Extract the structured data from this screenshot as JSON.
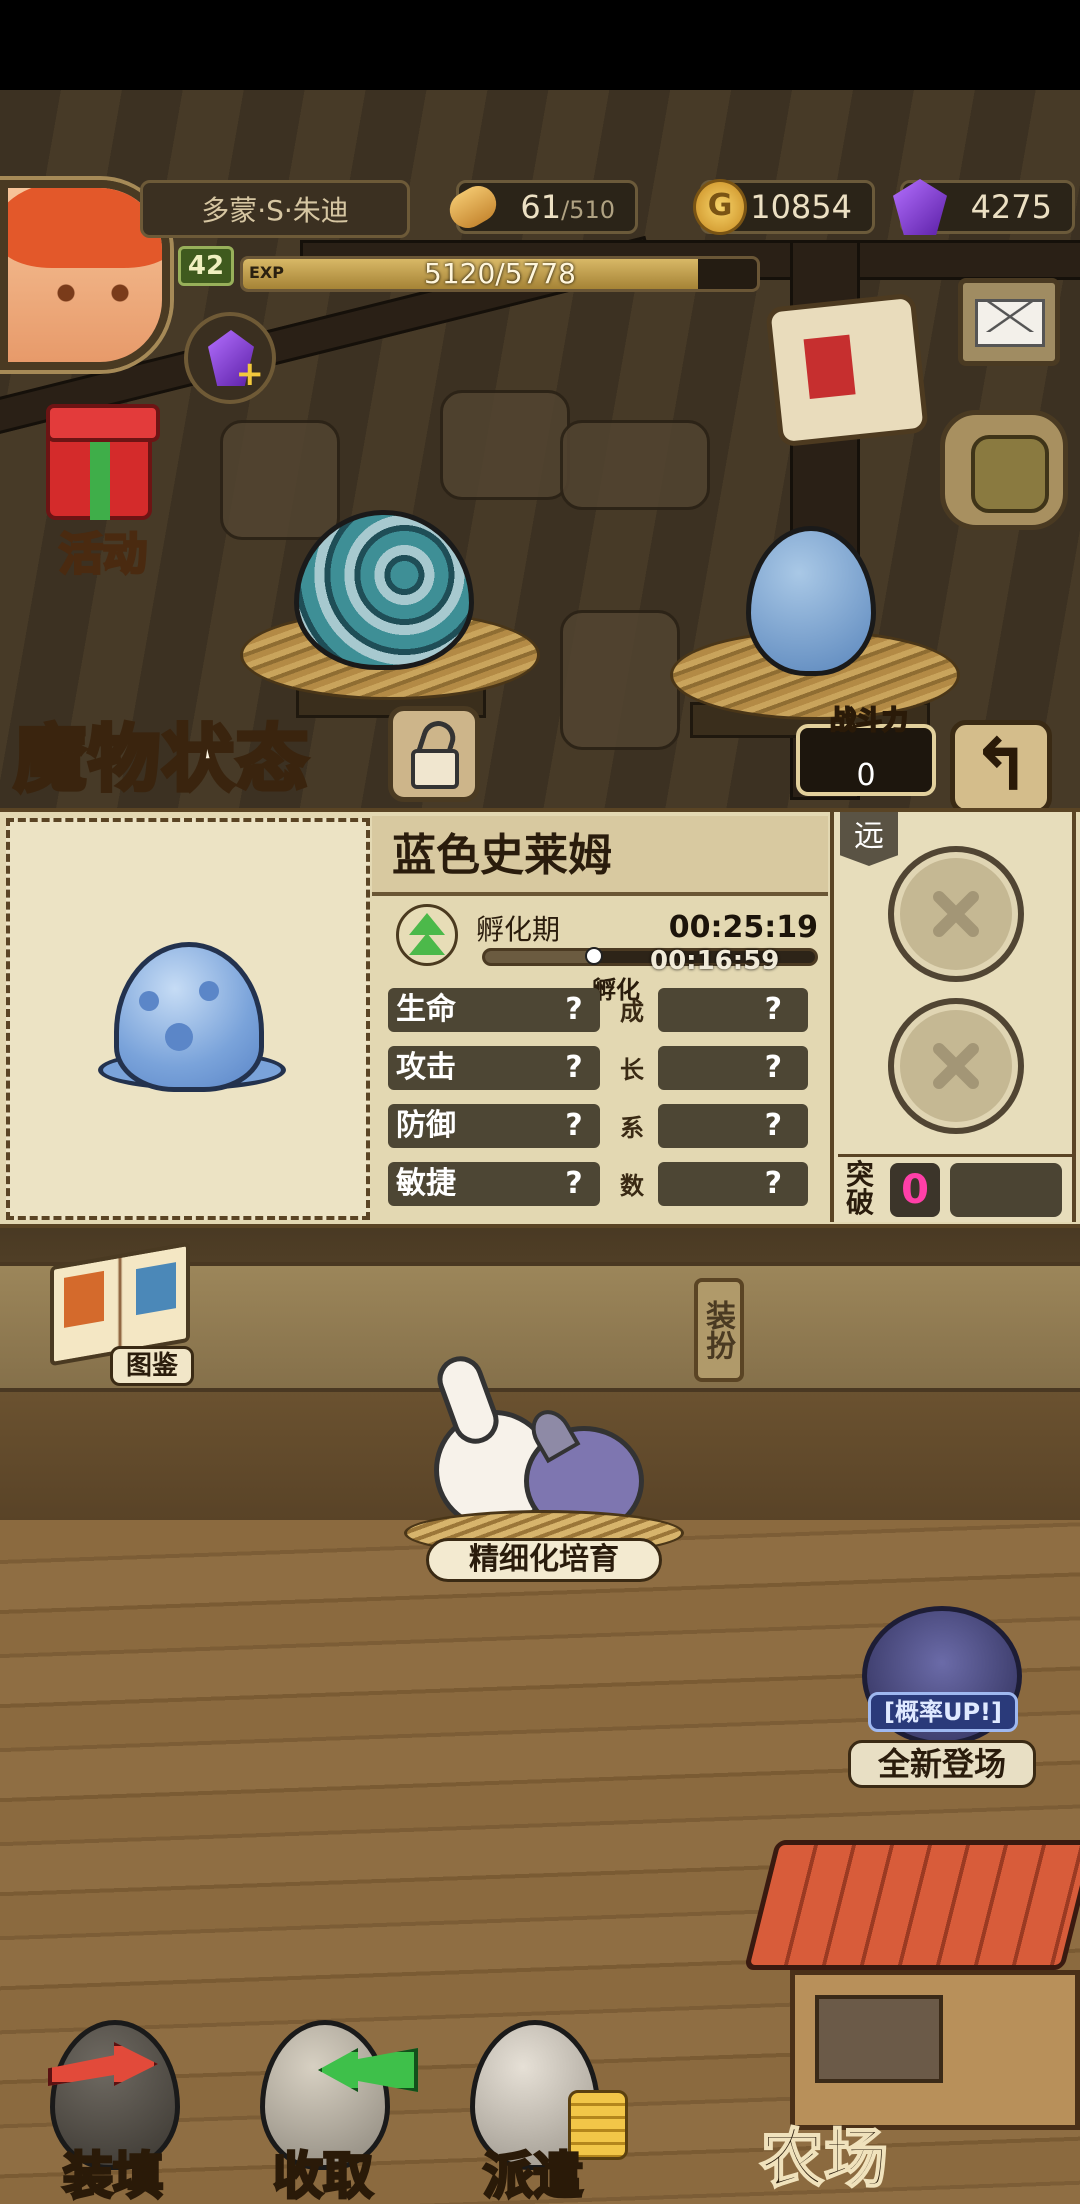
{
  "header": {
    "player_name": "多蒙·S·朱迪",
    "level": "42",
    "exp_tag": "EXP",
    "exp_text": "5120/5778",
    "exp_fraction": 0.886,
    "stamina": "61",
    "stamina_max": "/510",
    "gold": "10854",
    "gems": "4275",
    "gold_icon_letter": "G"
  },
  "buttons": {
    "activity": "活动",
    "back_symbol": "↰",
    "book": "图鉴",
    "dress": "装扮",
    "breed": "精细化培育",
    "gacha_up": "[概率UP!]",
    "gacha": "全新登场",
    "load": "装填",
    "collect": "收取",
    "dispatch": "派遣",
    "farm": "农场"
  },
  "panel": {
    "title": "魔物状态",
    "power_label": "战斗力",
    "power_value": "0",
    "monster_name": "蓝色史莱姆",
    "hatch_label": "孵化期",
    "hatch_total": "00:25:19",
    "hatch_remaining": "00:16:59",
    "hatch_progress": 0.33,
    "growth_header": "孵化",
    "growth_chars": [
      "成",
      "长",
      "系",
      "数"
    ],
    "stats": [
      {
        "name": "生命",
        "value": "?",
        "growth": "?"
      },
      {
        "name": "攻击",
        "value": "?",
        "growth": "?"
      },
      {
        "name": "防御",
        "value": "?",
        "growth": "?"
      },
      {
        "name": "敏捷",
        "value": "?",
        "growth": "?"
      }
    ],
    "range_tag": "远",
    "break_label": "突破",
    "break_value": "0"
  },
  "colors": {
    "break_value": "#ff3fa8",
    "hatch_arrow": "#4cb94a"
  }
}
